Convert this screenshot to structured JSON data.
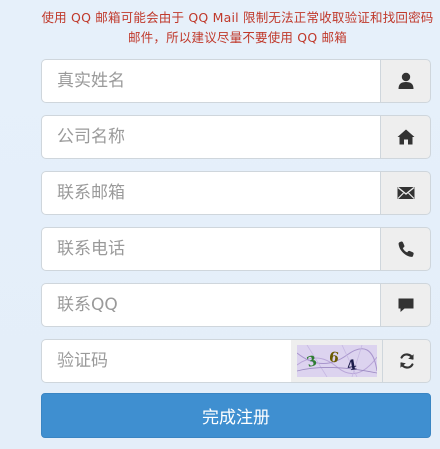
{
  "notice": "使用 QQ 邮箱可能会由于 QQ Mail 限制无法正常收取验证和找回密码邮件，所以建议尽量不要使用 QQ 邮箱",
  "fields": {
    "name": {
      "placeholder": "真实姓名",
      "icon": "user-icon"
    },
    "company": {
      "placeholder": "公司名称",
      "icon": "home-icon"
    },
    "email": {
      "placeholder": "联系邮箱",
      "icon": "envelope-icon"
    },
    "phone": {
      "placeholder": "联系电话",
      "icon": "phone-icon"
    },
    "qq": {
      "placeholder": "联系QQ",
      "icon": "comment-icon"
    },
    "captcha": {
      "placeholder": "验证码",
      "icon": "refresh-icon",
      "image_text": "364"
    }
  },
  "submit_label": "完成注册",
  "colors": {
    "notice": "#c0392b",
    "button": "#3f8fd0",
    "background": "#e6f0fa"
  }
}
